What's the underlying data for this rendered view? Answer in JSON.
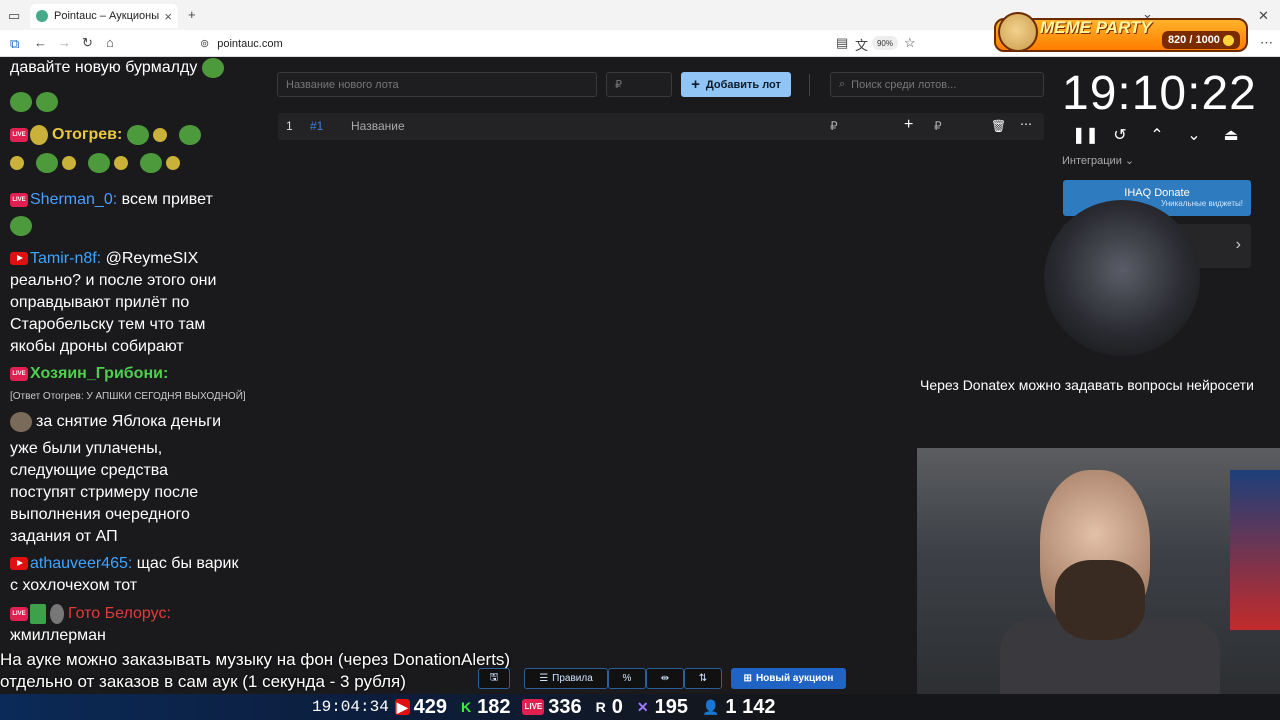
{
  "browser": {
    "tab_title": "Pointauc – Аукционы, лотереи",
    "url": "pointauc.com",
    "zoom": "90%"
  },
  "overlay": {
    "meme_title": "MEME PARTY",
    "meme_count": "820 / 1000"
  },
  "auction": {
    "new_lot_placeholder": "Название нового лота",
    "amount_placeholder": "₽",
    "add_lot_label": "Добавить лот",
    "search_placeholder": "Поиск среди лотов...",
    "row": {
      "index": "1",
      "id": "#1",
      "name": "Название",
      "currency": "₽"
    }
  },
  "timer": {
    "time": "19:10:22",
    "integrations_label": "Интеграции",
    "ihaq_title": "IHAQ Donate",
    "ihaq_sub": "Уникальные виджеты!"
  },
  "chat": {
    "messages": [
      {
        "user": "",
        "text": "давайте новую бурмалду"
      },
      {
        "user": "Отогрев:",
        "text": ""
      },
      {
        "user": "Sherman_0:",
        "text": "всем привет"
      },
      {
        "user": "Tamir-n8f:",
        "text": "@ReymeSIX"
      },
      {
        "user": "",
        "text": "реально? и после этого они"
      },
      {
        "user": "",
        "text": "оправдывают прилёт по"
      },
      {
        "user": "",
        "text": "Старобельску тем что там"
      },
      {
        "user": "",
        "text": "якобы дроны собирают"
      },
      {
        "user": "Хозяин_Грибони:",
        "text": ""
      },
      {
        "user": "",
        "text": "[Ответ Отогрев: У АПШКИ СЕГОДНЯ ВЫХОДНОЙ]"
      },
      {
        "user": "",
        "text": "за снятие Яблока деньги"
      },
      {
        "user": "",
        "text": "уже были уплачены,"
      },
      {
        "user": "",
        "text": "следующие средства"
      },
      {
        "user": "",
        "text": "поступят стримеру после"
      },
      {
        "user": "",
        "text": "выполнения очередного"
      },
      {
        "user": "",
        "text": "задания от АП"
      },
      {
        "user": "athauveer465:",
        "text": "щас бы варик"
      },
      {
        "user": "",
        "text": "с хохлочехом тот"
      },
      {
        "user": "Гото Белорус:",
        "text": ""
      },
      {
        "user": "",
        "text": "жмиллерман"
      }
    ]
  },
  "banners": {
    "line1": "На ауке можно заказывать музыку на фон (через DonationAlerts)",
    "line2": "отдельно от заказов в сам аук (1 секунда - 3 рубля)",
    "donatex": "Через Donatex можно задавать вопросы нейросети"
  },
  "toolbar": {
    "rules_label": "Правила",
    "percent_label": "%",
    "new_auction_label": "Новый аукцион"
  },
  "stats": {
    "clock": "19:04:34",
    "youtube": "429",
    "kick": "182",
    "live": "336",
    "r": "0",
    "other": "195",
    "viewers": "1 142"
  }
}
